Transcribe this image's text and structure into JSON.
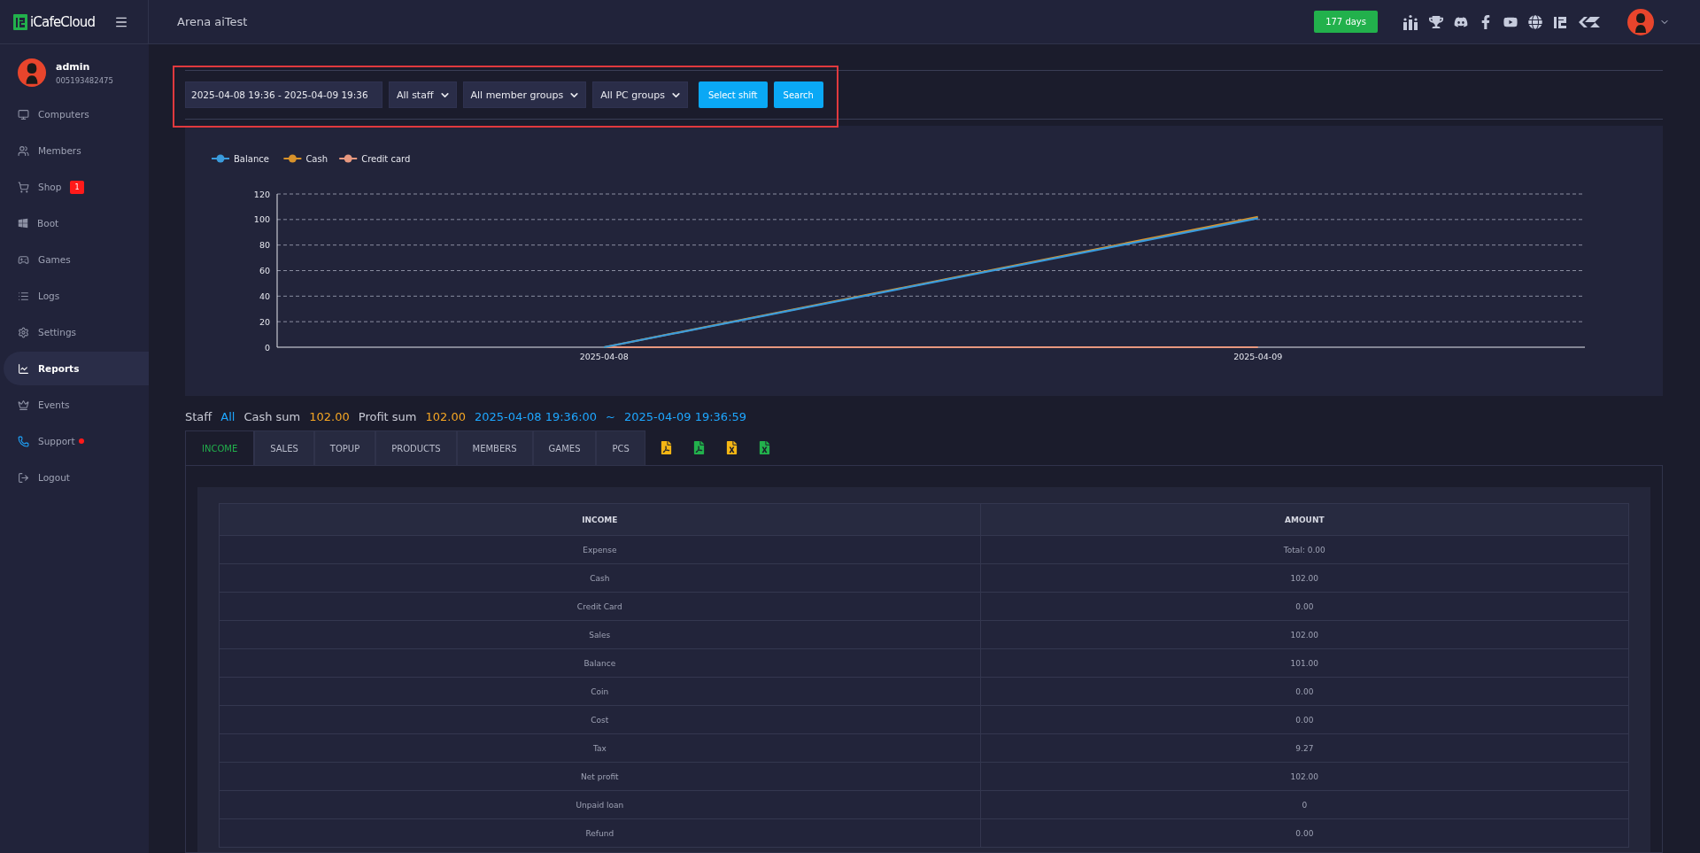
{
  "header": {
    "brand": "iCafeCloud",
    "title": "Arena aiTest",
    "license_badge": "177 days"
  },
  "sidebar": {
    "user": {
      "name": "admin",
      "id": "005193482475"
    },
    "items": [
      {
        "label": "Computers",
        "selected": false,
        "notification_dot": false
      },
      {
        "label": "Members",
        "selected": false,
        "notification_dot": false
      },
      {
        "label": "Shop",
        "selected": false,
        "notification_dot": false,
        "badge": "1"
      },
      {
        "label": "Boot",
        "selected": false,
        "notification_dot": false
      },
      {
        "label": "Games",
        "selected": false,
        "notification_dot": false
      },
      {
        "label": "Logs",
        "selected": false,
        "notification_dot": false
      },
      {
        "label": "Settings",
        "selected": false,
        "notification_dot": false
      },
      {
        "label": "Reports",
        "selected": true,
        "notification_dot": false
      },
      {
        "label": "Events",
        "selected": false,
        "notification_dot": false
      },
      {
        "label": "Support",
        "selected": false,
        "notification_dot": true
      },
      {
        "label": "Logout",
        "selected": false,
        "notification_dot": false
      }
    ]
  },
  "filters": {
    "date_range": "2025-04-08 19:36 - 2025-04-09 19:36",
    "selects": [
      "All staff",
      "All member groups",
      "All PC groups"
    ],
    "buttons": [
      "Select shift",
      "Search"
    ]
  },
  "chart_data": {
    "type": "line",
    "grid": true,
    "legend": true,
    "categories": [
      "2025-04-08",
      "2025-04-09"
    ],
    "ylim": [
      0,
      120
    ],
    "yticks": [
      0,
      20,
      40,
      60,
      80,
      100,
      120
    ],
    "series": [
      {
        "name": "Balance",
        "color": "#3a9bdc",
        "values": [
          0,
          101
        ]
      },
      {
        "name": "Cash",
        "color": "#d8922a",
        "values": [
          0,
          102
        ]
      },
      {
        "name": "Credit card",
        "color": "#e8987f",
        "values": [
          0,
          0
        ]
      }
    ]
  },
  "summary": [
    {
      "text": "Staff",
      "kind": "label"
    },
    {
      "text": "All",
      "kind": "date"
    },
    {
      "text": "Cash sum",
      "kind": "label"
    },
    {
      "text": "102.00",
      "kind": "value"
    },
    {
      "text": "Profit sum",
      "kind": "label"
    },
    {
      "text": "102.00",
      "kind": "value"
    },
    {
      "text": "2025-04-08 19:36:00",
      "kind": "date"
    },
    {
      "text": "~",
      "kind": "date"
    },
    {
      "text": "2025-04-09 19:36:59",
      "kind": "date"
    }
  ],
  "tabs": [
    {
      "label": "INCOME",
      "selected": true
    },
    {
      "label": "SALES",
      "selected": false
    },
    {
      "label": "TOPUP",
      "selected": false
    },
    {
      "label": "PRODUCTS",
      "selected": false
    },
    {
      "label": "MEMBERS",
      "selected": false
    },
    {
      "label": "GAMES",
      "selected": false
    },
    {
      "label": "PCS",
      "selected": false
    }
  ],
  "table": {
    "columns": [
      "INCOME",
      "AMOUNT"
    ],
    "rows": [
      [
        "Expense",
        "Total: 0.00"
      ],
      [
        "Cash",
        "102.00"
      ],
      [
        "Credit Card",
        "0.00"
      ],
      [
        "Sales",
        "102.00"
      ],
      [
        "Balance",
        "101.00"
      ],
      [
        "Coin",
        "0.00"
      ],
      [
        "Cost",
        "0.00"
      ],
      [
        "Tax",
        "9.27"
      ],
      [
        "Net profit",
        "102.00"
      ],
      [
        "Unpaid loan",
        "0"
      ],
      [
        "Refund",
        "0.00"
      ]
    ]
  }
}
